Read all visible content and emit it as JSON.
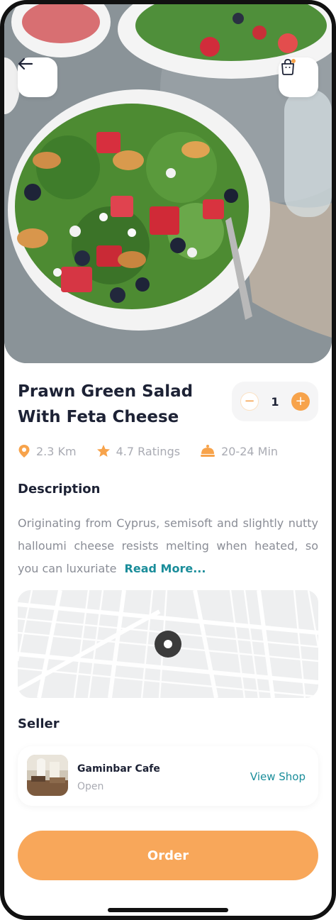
{
  "product": {
    "title_line1": "Prawn Green Salad",
    "title_line2": "With Feta Cheese",
    "quantity": "1",
    "minus_symbol": "−",
    "plus_symbol": "+"
  },
  "meta": {
    "distance": "2.3 Km",
    "rating": "4.7 Ratings",
    "time": "20-24 Min"
  },
  "description": {
    "heading": "Description",
    "text": "Originating from Cyprus, semisoft and slightly nutty halloumi cheese resists melting when heated, so you can luxuriate",
    "read_more": "Read More..."
  },
  "seller": {
    "heading": "Seller",
    "name": "Gaminbar Cafe",
    "status": "Open",
    "view_shop": "View Shop"
  },
  "order": {
    "label": "Order"
  },
  "colors": {
    "accent": "#F8A75A",
    "link": "#1A8D9A",
    "text_dark": "#1D2235",
    "text_muted": "#A9ABB3"
  },
  "icons": {
    "back": "arrow-left-icon",
    "bag": "shopping-bag-icon",
    "location": "location-pin-icon",
    "rating": "star-icon",
    "time": "food-cloche-icon",
    "map_marker": "map-pin-icon"
  }
}
